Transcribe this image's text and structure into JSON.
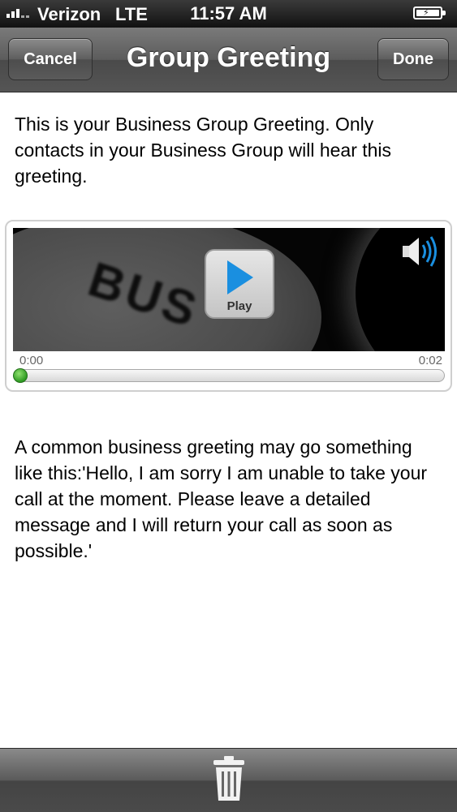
{
  "status_bar": {
    "carrier": "Verizon",
    "network": "LTE",
    "time": "11:57 AM",
    "icons": [
      "signal-bars-icon",
      "battery-charging-icon"
    ]
  },
  "nav": {
    "title": "Group Greeting",
    "cancel_label": "Cancel",
    "done_label": "Done"
  },
  "intro_text": "This is your Business Group Greeting. Only contacts in your Business Group will hear this greeting.",
  "player": {
    "watermark": "BUS",
    "play_label": "Play",
    "time_current": "0:00",
    "time_total": "0:02",
    "progress": 0.0,
    "icons": [
      "play-icon",
      "speaker-icon"
    ]
  },
  "example_text": "A common business greeting may go something like this:'Hello, I am sorry I am unable to take your call at the moment. Please leave a detailed message and I will return your call as soon as possible.'",
  "toolbar": {
    "icons": [
      "trash-icon"
    ]
  },
  "colors": {
    "play_accent": "#1a8fe0",
    "progress_knob": "#3fb32c",
    "bar_gray": "#5a5a5a"
  }
}
